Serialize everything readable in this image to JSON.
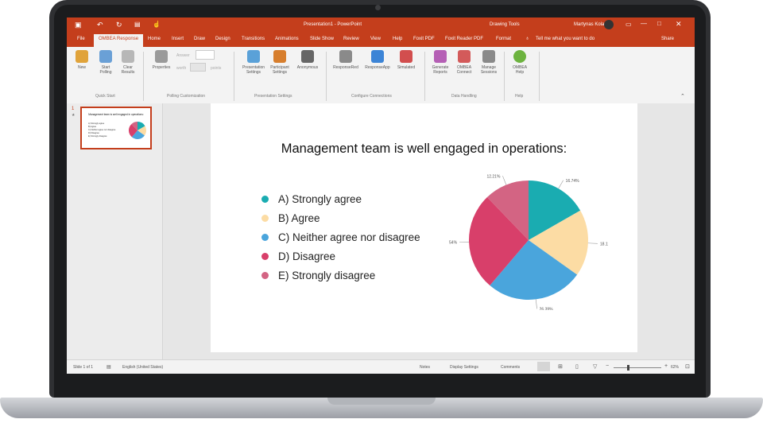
{
  "titlebar": {
    "app_title": "Presentation1 - PowerPoint",
    "context_tab": "Drawing Tools",
    "user": "Martynas Kolas"
  },
  "tabs": [
    "File",
    "OMBEA Response",
    "Home",
    "Insert",
    "Draw",
    "Design",
    "Transitions",
    "Animations",
    "Slide Show",
    "Review",
    "View",
    "Help",
    "Foxit PDF",
    "Foxit Reader PDF",
    "Format"
  ],
  "tell_me": "Tell me what you want to do",
  "share": "Share",
  "ribbon": {
    "buttons": [
      {
        "label": "New",
        "color": "#e0a33a"
      },
      {
        "label": "Start Polling",
        "color": "#6aa0d6"
      },
      {
        "label": "Clear Results",
        "color": "#b7b7b7"
      },
      {
        "label": "Properties",
        "color": "#9a9a9a"
      },
      {
        "label": "Presentation Settings",
        "color": "#5aa1d8"
      },
      {
        "label": "Participant Settings",
        "color": "#d77e2d"
      },
      {
        "label": "Anonymous",
        "color": "#666666"
      },
      {
        "label": "ResponseRed",
        "color": "#8a8a8a"
      },
      {
        "label": "ResponseApp",
        "color": "#3c84d6"
      },
      {
        "label": "Simulated",
        "color": "#d24e4e"
      },
      {
        "label": "Generate Reports",
        "color": "#b55fb5"
      },
      {
        "label": "OMBEA Connect",
        "color": "#d35a5a"
      },
      {
        "label": "Manage Sessions",
        "color": "#8a8a8a"
      },
      {
        "label": "OMBEA Help",
        "color": "#6db33f"
      }
    ],
    "small": {
      "answer": "Answer",
      "points": "points",
      "worth": "worth"
    },
    "groups": [
      "Quick Start",
      "Polling Customization",
      "Presentation Settings",
      "Configure Connections",
      "Data Handling",
      "Help"
    ]
  },
  "slide_number": "1",
  "slide": {
    "title": "Management team is well engaged in operations:",
    "options": [
      {
        "text": "A)  Strongly agree",
        "color": "#1aacb1"
      },
      {
        "text": "B)  Agree",
        "color": "#fcdca4"
      },
      {
        "text": "C)  Neither agree nor disagree",
        "color": "#4aa5dc"
      },
      {
        "text": "D)  Disagree",
        "color": "#d83f6a"
      },
      {
        "text": "E)  Strongly disagree",
        "color": "#d36483"
      }
    ]
  },
  "chart_data": {
    "type": "pie",
    "categories": [
      "Strongly agree",
      "Agree",
      "Neither agree nor disagree",
      "Disagree",
      "Strongly disagree"
    ],
    "values": [
      16.74,
      18.11,
      26.39,
      26.54,
      12.21
    ],
    "labels": [
      "16.74%",
      "18.11%",
      "26.39%",
      "26.54%",
      "12.21%"
    ],
    "colors": [
      "#1aacb1",
      "#fcdca4",
      "#4aa5dc",
      "#d83f6a",
      "#d36483"
    ]
  },
  "thumbnail": {
    "title": "Management team is well engaged in operations:",
    "options": [
      "A) Strongly agree",
      "B) Agree",
      "C) Neither agree nor disagree",
      "D) Disagree",
      "E) Strongly disagree"
    ]
  },
  "status": {
    "slide_info": "Slide 1 of 1",
    "language": "English (United States)",
    "notes": "Notes",
    "display_settings": "Display Settings",
    "comments": "Comments",
    "zoom": "62%"
  }
}
